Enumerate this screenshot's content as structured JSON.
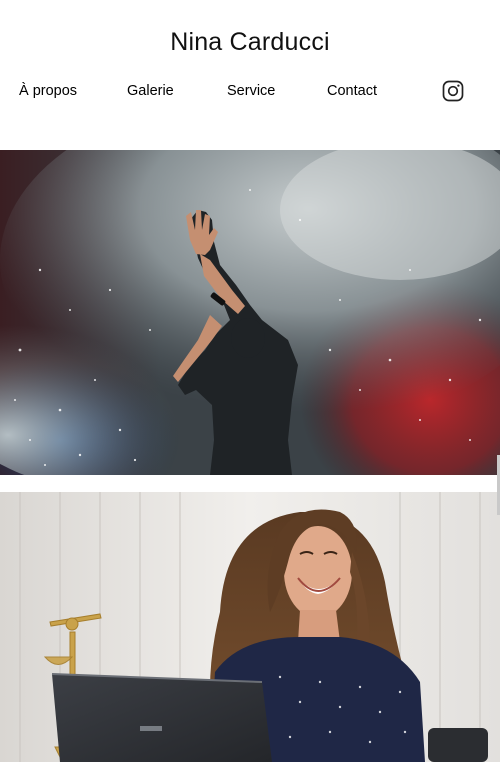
{
  "header": {
    "title": "Nina Carducci"
  },
  "nav": {
    "items": [
      {
        "label": "À propos"
      },
      {
        "label": "Galerie"
      },
      {
        "label": "Service"
      },
      {
        "label": "Contact"
      }
    ],
    "social_icon": "instagram-icon"
  },
  "hero": {
    "image": "concert-performer-smoke-photo"
  },
  "second": {
    "image": "laughing-woman-laptop-photo"
  },
  "colors": {
    "text": "#000000",
    "background": "#ffffff"
  }
}
